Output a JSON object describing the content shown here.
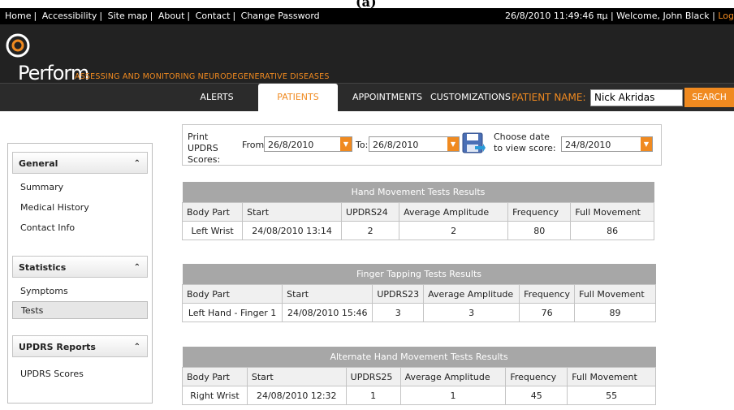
{
  "figure_label": "(a)",
  "topbar": {
    "links": [
      "Home",
      "Accessibility",
      "Site map",
      "About",
      "Contact",
      "Change Password"
    ],
    "datetime": "26/8/2010 11:49:46 πμ",
    "welcome": "| Welcome, John Black |",
    "logout": "Log"
  },
  "branding": {
    "logo_text": "Perform",
    "tagline": "ASSESSING AND MONITORING NEURODEGENERATIVE DISEASES"
  },
  "nav": {
    "tabs": [
      "ALERTS",
      "PATIENTS",
      "APPOINTMENTS",
      "CUSTOMIZATIONS"
    ],
    "active_tab": "PATIENTS",
    "patient_label": "PATIENT NAME:",
    "patient_value": "Nick Akridas",
    "search_label": "SEARCH"
  },
  "sidebar": {
    "groups": [
      {
        "title": "General",
        "items": [
          "Summary",
          "Medical History",
          "Contact Info"
        ]
      },
      {
        "title": "Statistics",
        "items": [
          "Symptoms",
          "Tests"
        ],
        "selected": "Tests"
      },
      {
        "title": "UPDRS Reports",
        "items": [
          "UPDRS Scores"
        ]
      }
    ]
  },
  "filter": {
    "print_label": "Print UPDRS Scores:",
    "from_label": "From:",
    "from_value": "26/8/2010",
    "to_label": "To:",
    "to_value": "26/8/2010",
    "choose_label": "Choose date to view score:",
    "choose_value": "24/8/2010"
  },
  "tables": [
    {
      "title": "Hand Movement Tests Results",
      "columns": [
        "Body Part",
        "Start",
        "UPDRS24",
        "Average Amplitude",
        "Frequency",
        "Full Movement"
      ],
      "rows": [
        [
          "Left Wrist",
          "24/08/2010 13:14",
          "2",
          "2",
          "80",
          "86"
        ]
      ]
    },
    {
      "title": "Finger Tapping Tests Results",
      "columns": [
        "Body Part",
        "Start",
        "UPDRS23",
        "Average Amplitude",
        "Frequency",
        "Full Movement"
      ],
      "rows": [
        [
          "Left Hand - Finger 1",
          "24/08/2010 15:46",
          "3",
          "3",
          "76",
          "89"
        ]
      ]
    },
    {
      "title": "Alternate Hand Movement Tests Results",
      "columns": [
        "Body Part",
        "Start",
        "UPDRS25",
        "Average Amplitude",
        "Frequency",
        "Full Movement"
      ],
      "rows": [
        [
          "Right Wrist",
          "24/08/2010 12:32",
          "1",
          "1",
          "45",
          "55"
        ]
      ]
    }
  ],
  "colors": {
    "accent": "#f08a20",
    "header_bg": "#222222",
    "table_title_bg": "#a7a7a7"
  }
}
